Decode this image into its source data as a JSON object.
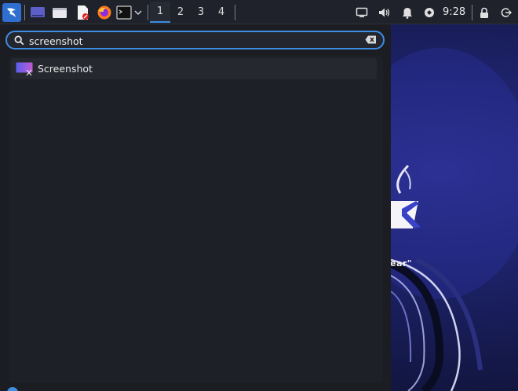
{
  "panel": {
    "workspaces": [
      "1",
      "2",
      "3",
      "4"
    ],
    "active_workspace": "1",
    "clock": "9:28"
  },
  "launcher": {
    "search_value": "screenshot",
    "results": [
      {
        "label": "Screenshot",
        "icon": "screenshot-app-icon"
      }
    ]
  },
  "wallpaper": {
    "visible_text": "ear\""
  },
  "colors": {
    "accent": "#3d8de3",
    "panel_bg": "#1f222b",
    "launcher_bg": "#1b1d23"
  }
}
